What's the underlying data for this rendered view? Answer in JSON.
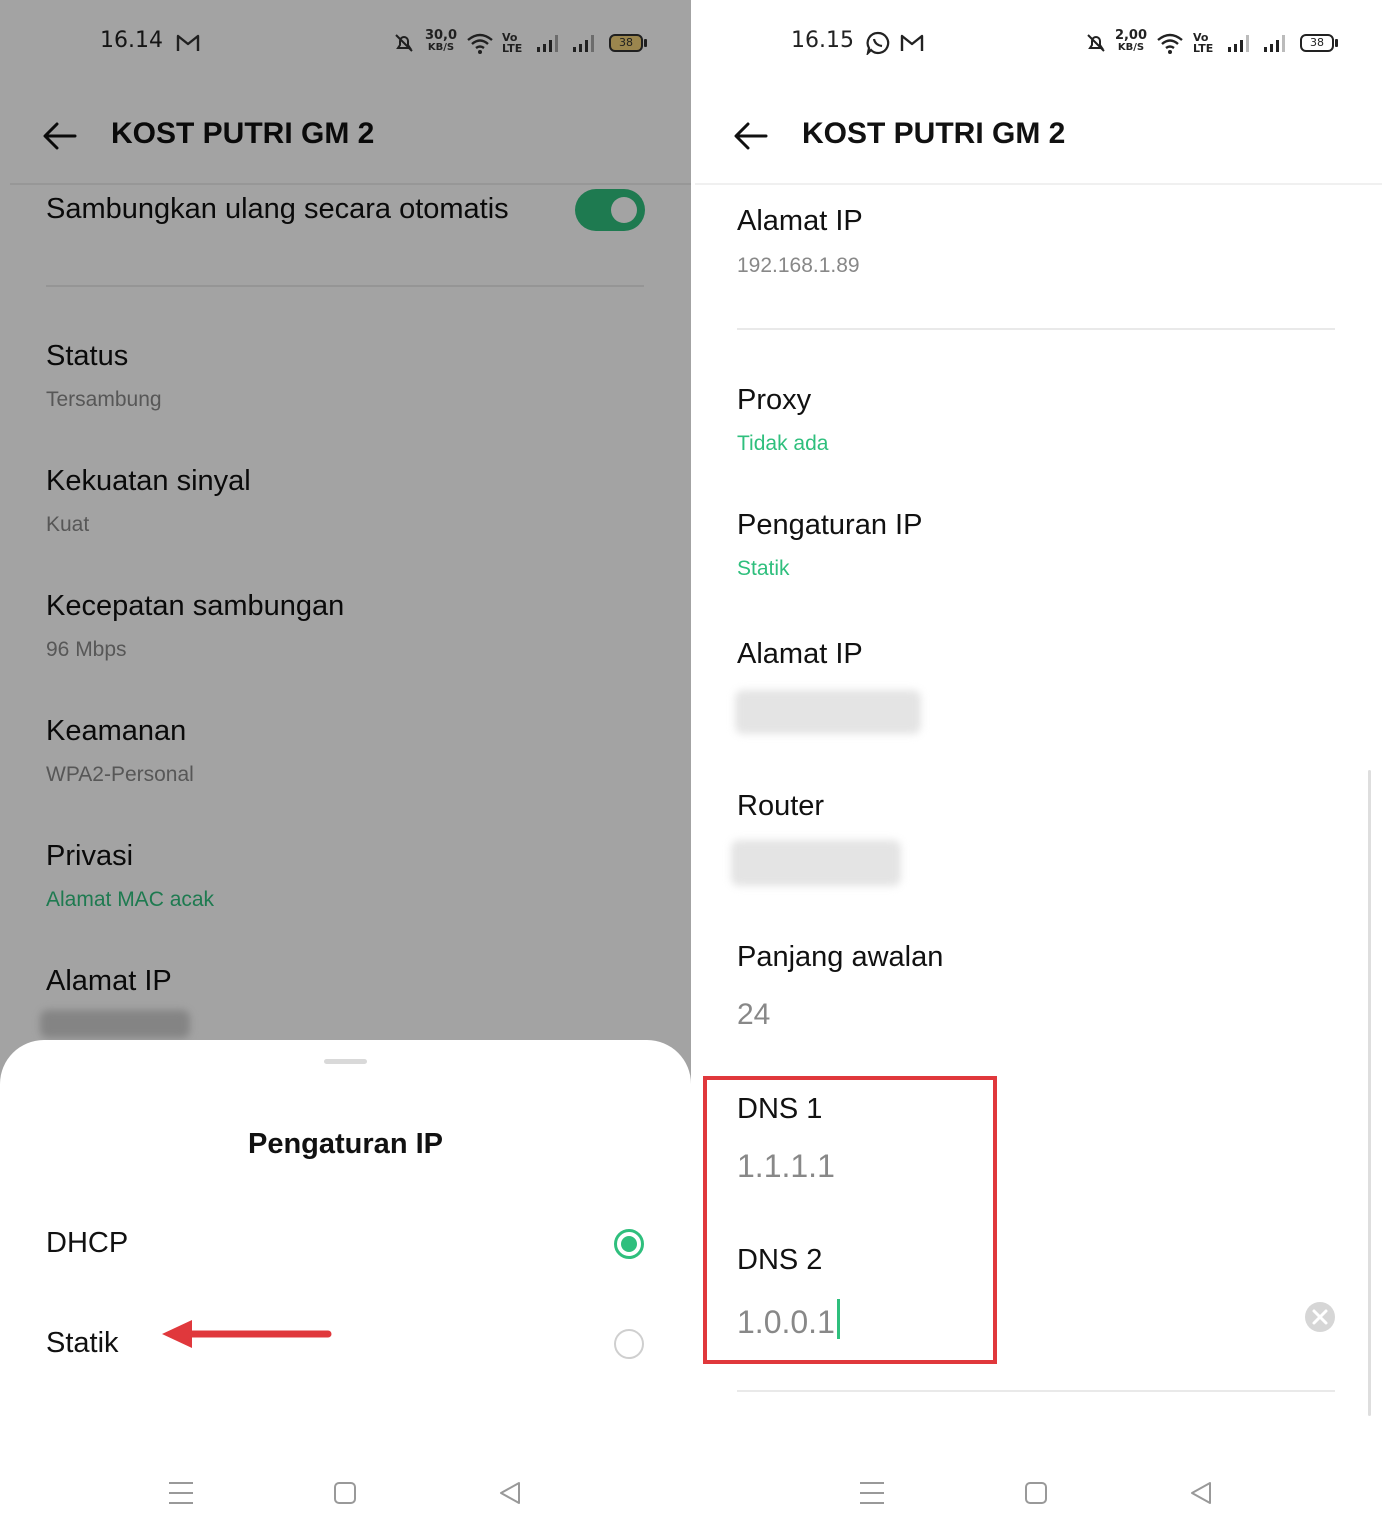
{
  "left": {
    "status_bar": {
      "time": "16.14",
      "net_speed_value": "30,0",
      "net_speed_unit": "KB/S",
      "volte": "Vo LTE",
      "battery": "38"
    },
    "header": {
      "title": "KOST PUTRI GM 2"
    },
    "auto_reconnect": {
      "label": "Sambungkan ulang secara otomatis"
    },
    "items": [
      {
        "label": "Status",
        "value": "Tersambung"
      },
      {
        "label": "Kekuatan sinyal",
        "value": "Kuat"
      },
      {
        "label": "Kecepatan sambungan",
        "value": "96 Mbps"
      },
      {
        "label": "Keamanan",
        "value": "WPA2-Personal"
      },
      {
        "label": "Privasi",
        "value": "Alamat MAC acak"
      },
      {
        "label": "Alamat IP"
      }
    ],
    "sheet": {
      "title": "Pengaturan IP",
      "options": [
        {
          "label": "DHCP",
          "selected": true
        },
        {
          "label": "Statik",
          "selected": false
        }
      ]
    }
  },
  "right": {
    "status_bar": {
      "time": "16.15",
      "net_speed_value": "2,00",
      "net_speed_unit": "KB/S",
      "volte": "Vo LTE",
      "battery": "38"
    },
    "header": {
      "title": "KOST PUTRI GM 2"
    },
    "items": {
      "ip_top": {
        "label": "Alamat IP",
        "value": "192.168.1.89"
      },
      "proxy": {
        "label": "Proxy",
        "value": "Tidak ada"
      },
      "ip_settings": {
        "label": "Pengaturan IP",
        "value": "Statik"
      },
      "ip_address": {
        "label": "Alamat IP"
      },
      "router": {
        "label": "Router"
      },
      "prefix": {
        "label": "Panjang awalan",
        "value": "24"
      },
      "dns1": {
        "label": "DNS 1",
        "value": "1.1.1.1"
      },
      "dns2": {
        "label": "DNS 2",
        "value": "1.0.0.1"
      }
    }
  },
  "colors": {
    "accent": "#2fbf7d",
    "highlight": "#e0383c"
  }
}
